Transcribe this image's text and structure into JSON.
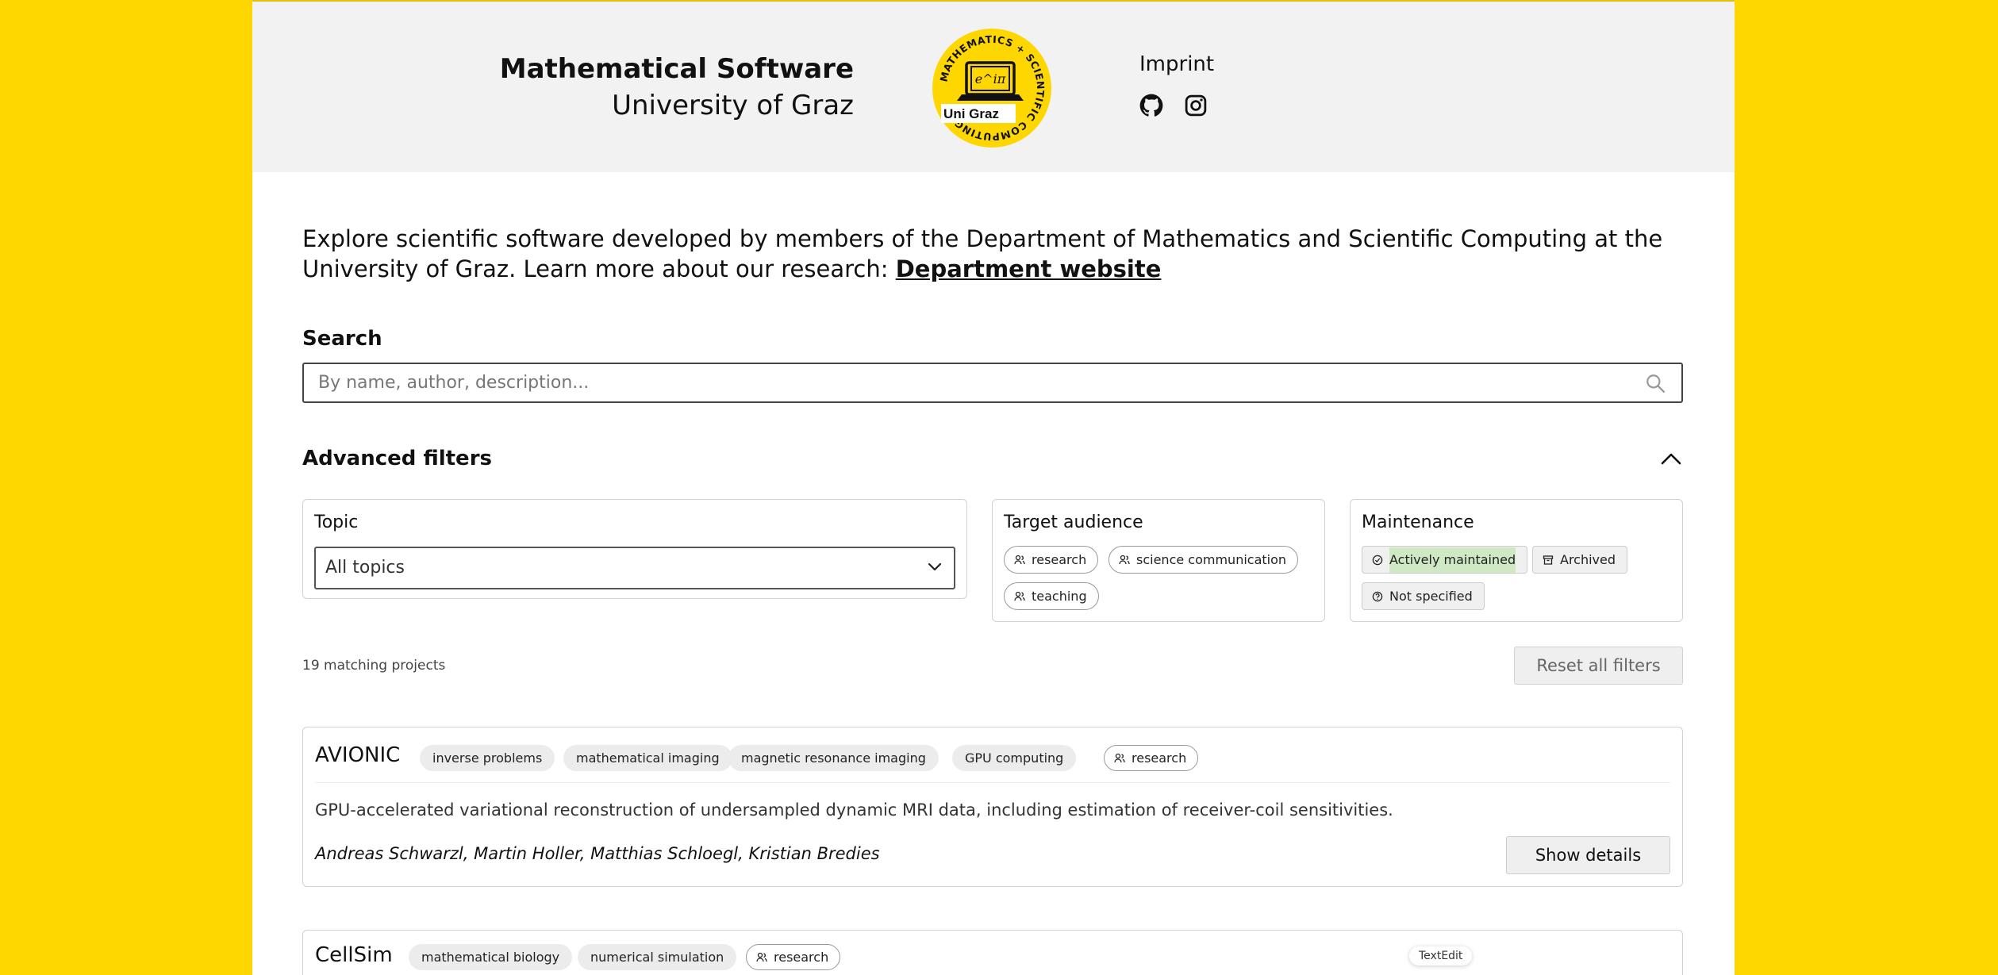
{
  "header": {
    "title": "Mathematical Software",
    "subtitle": "University of Graz",
    "logo": {
      "ring_text": "MATHEMATICS + SCIENTIFIC COMPUTING",
      "label": "Uni Graz",
      "screen_text": "e^iπ"
    },
    "imprint_link": "Imprint",
    "social_icons": [
      "github-icon",
      "instagram-icon"
    ]
  },
  "intro": {
    "text": "Explore scientific software developed by members of the Department of Mathematics and Scientific Computing at the University of Graz. Learn more about our research: ",
    "link_text": "Department website"
  },
  "search": {
    "label": "Search",
    "placeholder": "By name, author, description..."
  },
  "advanced": {
    "title": "Advanced filters",
    "topic": {
      "label": "Topic",
      "selected": "All topics"
    },
    "audience": {
      "label": "Target audience",
      "options": [
        "research",
        "science communication",
        "teaching"
      ]
    },
    "maintenance": {
      "label": "Maintenance",
      "options": [
        "Actively maintained",
        "Archived",
        "Not specified"
      ]
    }
  },
  "results": {
    "count_text": "19 matching projects",
    "reset_label": "Reset all filters"
  },
  "projects": [
    {
      "name": "AVIONIC",
      "tags": [
        "inverse problems",
        "mathematical imaging",
        "magnetic resonance imaging",
        "GPU computing"
      ],
      "audience": "research",
      "description": "GPU-accelerated variational reconstruction of undersampled dynamic MRI data, including estimation of receiver-coil sensitivities.",
      "authors": "Andreas Schwarzl, Martin Holler, Matthias Schloegl, Kristian Bredies",
      "details_label": "Show details"
    },
    {
      "name": "CellSim",
      "tags": [
        "mathematical biology",
        "numerical simulation"
      ],
      "audience": "research"
    }
  ],
  "tooltip": "TextEdit",
  "colors": {
    "background": "#FFD700",
    "header_bg": "#f2f2f2",
    "highlight": "#cfe9c4"
  }
}
